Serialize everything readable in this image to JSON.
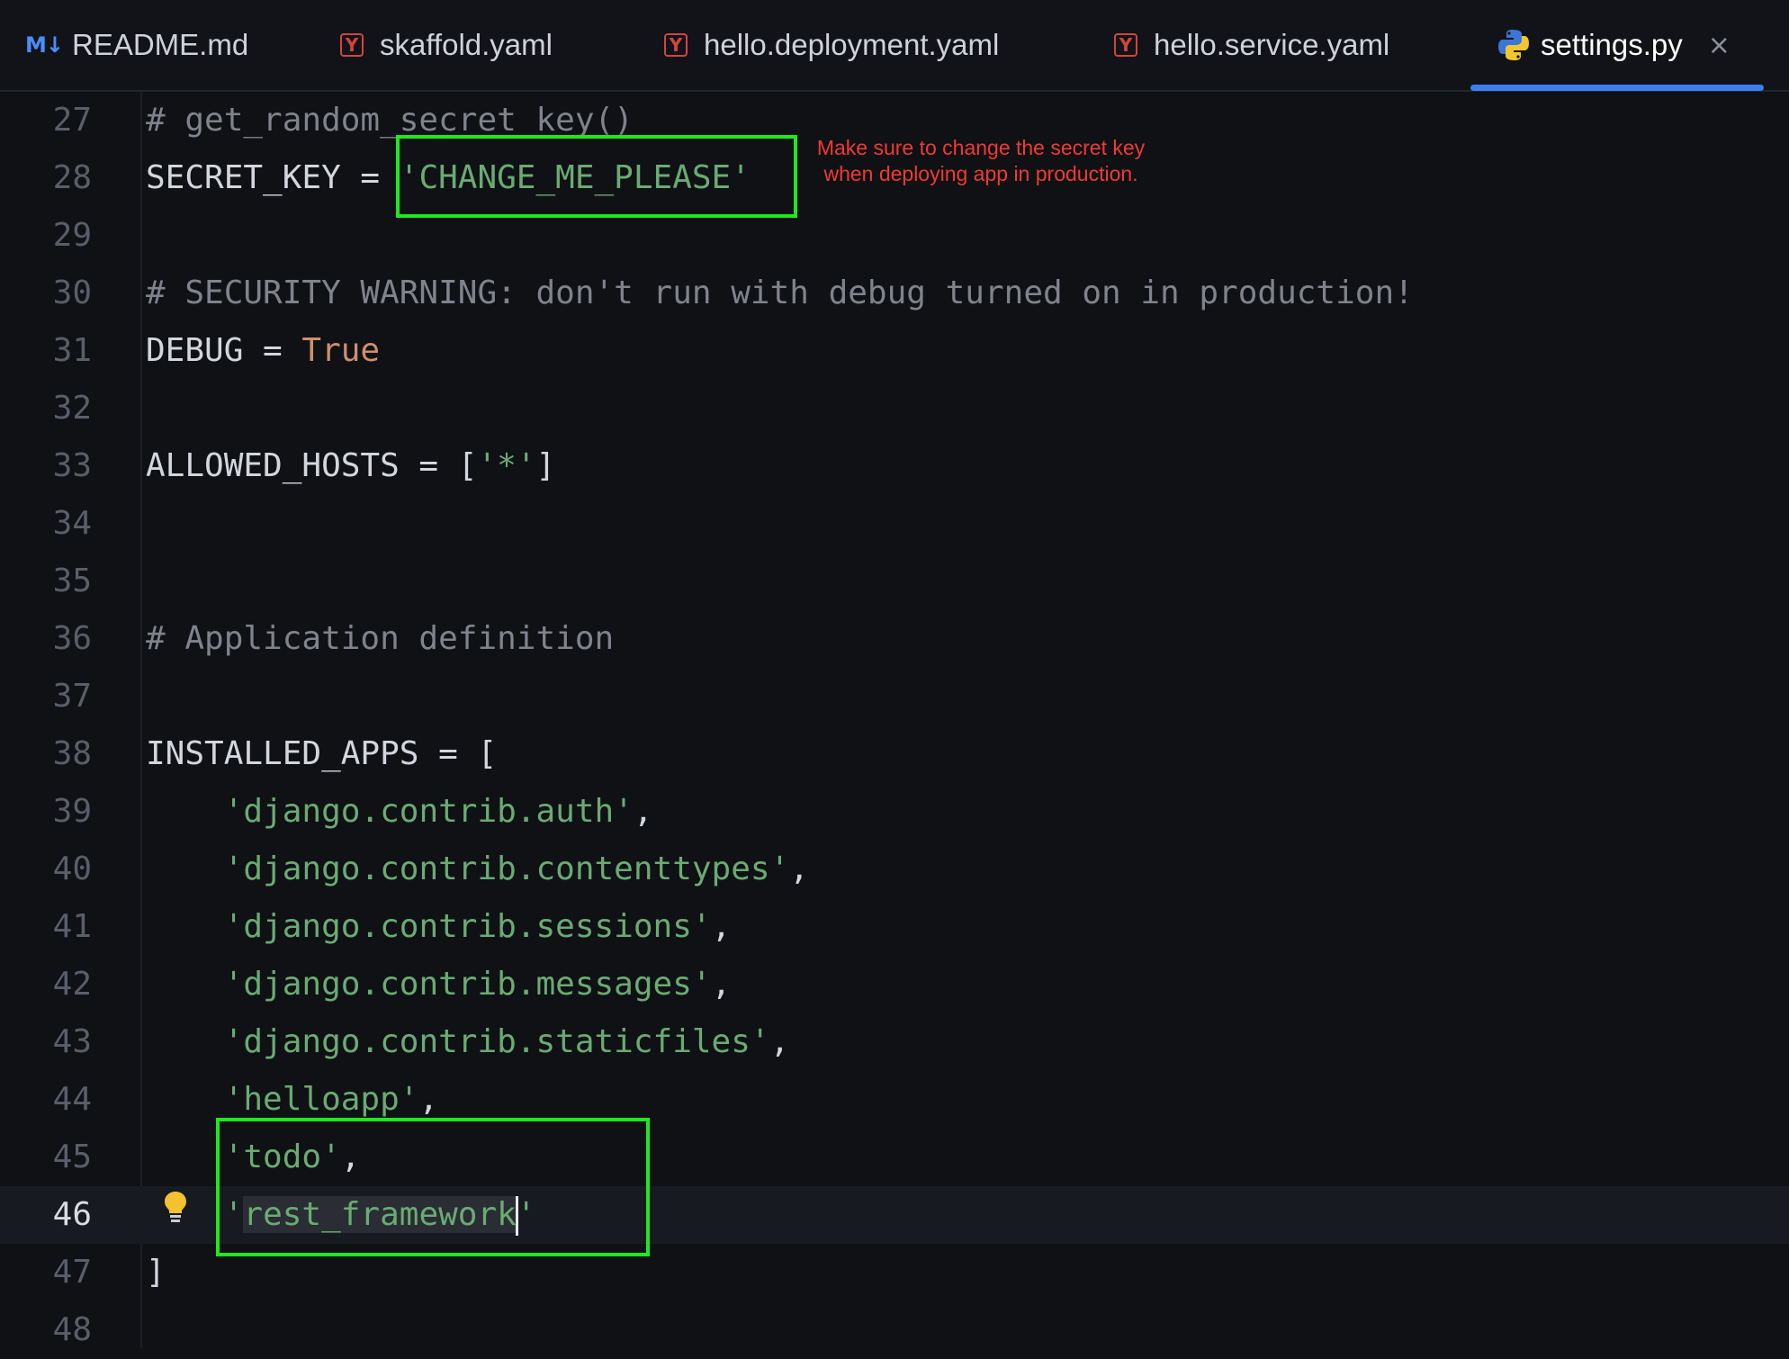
{
  "tabs": [
    {
      "icon": "markdown-icon",
      "icon_text": "M↓",
      "label": "README.md"
    },
    {
      "icon": "yaml-icon",
      "icon_text": "Y",
      "label": "skaffold.yaml"
    },
    {
      "icon": "yaml-icon",
      "icon_text": "Y",
      "label": "hello.deployment.yaml"
    },
    {
      "icon": "yaml-icon",
      "icon_text": "Y",
      "label": "hello.service.yaml"
    },
    {
      "icon": "python-icon",
      "label": "settings.py",
      "active": true,
      "close": "×"
    }
  ],
  "annotation": {
    "note": "Make sure to change the secret key when deploying app in production."
  },
  "colors": {
    "accent": "#3b7ff0",
    "highlight_box": "#1de91d",
    "note_text": "#f03a32",
    "string": "#6aab73",
    "keyword": "#cf8e6d",
    "comment": "#80838b"
  },
  "editor": {
    "current_line": 46,
    "lines": [
      {
        "n": "27",
        "text": "# get_random_secret_key()"
      },
      {
        "n": "28",
        "text_a": "SECRET_KEY = ",
        "text_b": "'CHANGE_ME_PLEASE'"
      },
      {
        "n": "29",
        "text": ""
      },
      {
        "n": "30",
        "text": "# SECURITY WARNING: don't run with debug turned on in production!"
      },
      {
        "n": "31",
        "text_a": "DEBUG = ",
        "text_b": "True"
      },
      {
        "n": "32",
        "text": ""
      },
      {
        "n": "33",
        "text_a": "ALLOWED_HOSTS = [",
        "text_b": "'*'",
        "text_c": "]"
      },
      {
        "n": "34",
        "text": ""
      },
      {
        "n": "35",
        "text": ""
      },
      {
        "n": "36",
        "text": "# Application definition"
      },
      {
        "n": "37",
        "text": ""
      },
      {
        "n": "38",
        "text": "INSTALLED_APPS = ["
      },
      {
        "n": "39",
        "indent": "    ",
        "text_b": "'django.contrib.auth'",
        "text_c": ","
      },
      {
        "n": "40",
        "indent": "    ",
        "text_b": "'django.contrib.contenttypes'",
        "text_c": ","
      },
      {
        "n": "41",
        "indent": "    ",
        "text_b": "'django.contrib.sessions'",
        "text_c": ","
      },
      {
        "n": "42",
        "indent": "    ",
        "text_b": "'django.contrib.messages'",
        "text_c": ","
      },
      {
        "n": "43",
        "indent": "    ",
        "text_b": "'django.contrib.staticfiles'",
        "text_c": ","
      },
      {
        "n": "44",
        "indent": "    ",
        "text_b": "'helloapp'",
        "text_c": ","
      },
      {
        "n": "45",
        "indent": "    ",
        "text_b": "'todo'",
        "text_c": ","
      },
      {
        "n": "46",
        "indent": "    ",
        "q1": "'",
        "sel": "rest_framework",
        "q2": "'"
      },
      {
        "n": "47",
        "text": "]"
      },
      {
        "n": "48",
        "text": ""
      }
    ]
  }
}
